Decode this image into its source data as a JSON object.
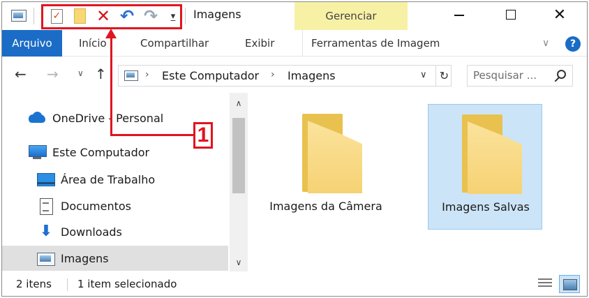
{
  "window": {
    "title": "Imagens",
    "context_tab_group": "Gerenciar"
  },
  "quick_access_toolbar": {
    "icons": [
      "properties-icon",
      "new-folder-icon",
      "delete-icon",
      "undo-icon",
      "redo-icon",
      "customize-dropdown-icon"
    ]
  },
  "ribbon": {
    "tabs": [
      {
        "label": "Arquivo"
      },
      {
        "label": "Início"
      },
      {
        "label": "Compartilhar"
      },
      {
        "label": "Exibir"
      },
      {
        "label": "Ferramentas de Imagem"
      }
    ]
  },
  "address": {
    "crumbs": [
      "Este Computador",
      "Imagens"
    ]
  },
  "search": {
    "placeholder": "Pesquisar ..."
  },
  "nav_pane": {
    "items": [
      {
        "label": "OneDrive - Personal",
        "icon": "onedrive-icon"
      },
      {
        "label": "Este Computador",
        "icon": "computer-icon"
      },
      {
        "label": "Área de Trabalho",
        "icon": "desktop-icon"
      },
      {
        "label": "Documentos",
        "icon": "documents-icon"
      },
      {
        "label": "Downloads",
        "icon": "downloads-icon"
      },
      {
        "label": "Imagens",
        "icon": "pictures-icon",
        "selected": true
      }
    ]
  },
  "content": {
    "folders": [
      {
        "label": "Imagens da Câmera"
      },
      {
        "label": "Imagens Salvas",
        "selected": true
      }
    ]
  },
  "status": {
    "count": "2 itens",
    "selection": "1 item selecionado"
  },
  "annotation": {
    "callout_number": "1",
    "color": "#e0151f"
  },
  "colors": {
    "accent": "#1a6cc6",
    "context_tab": "#f7f1a6",
    "selection": "#cce4f7"
  }
}
